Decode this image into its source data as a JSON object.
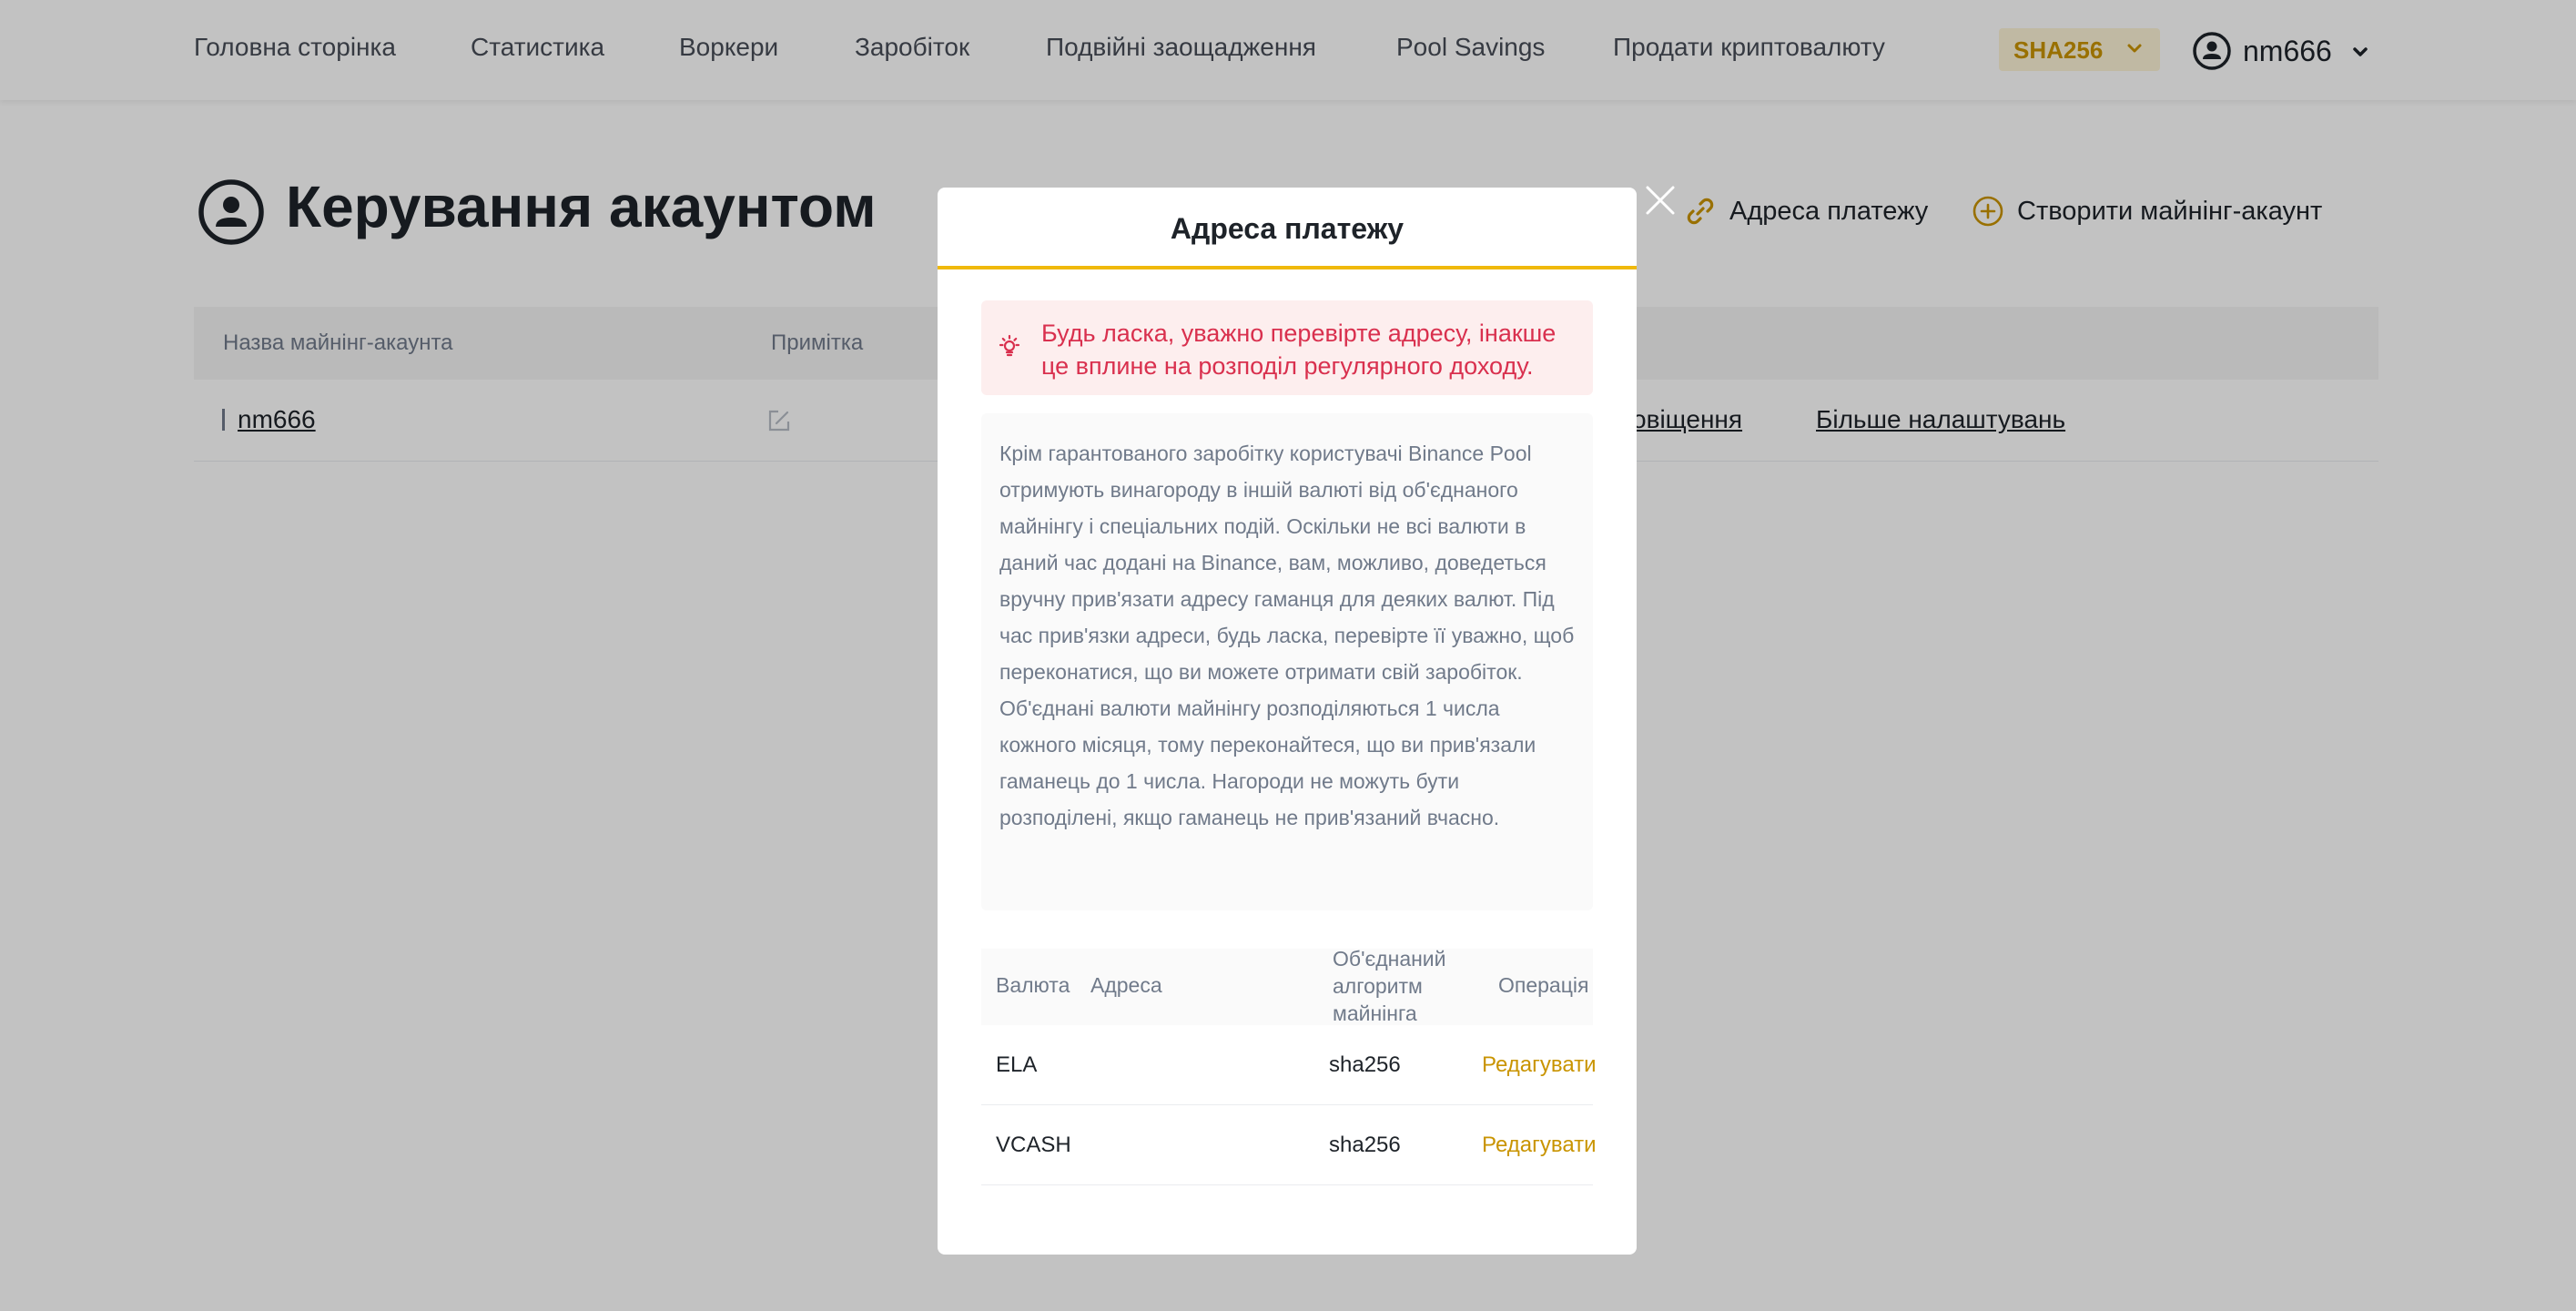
{
  "nav": {
    "items": [
      {
        "label": "Головна сторінка"
      },
      {
        "label": "Статистика"
      },
      {
        "label": "Воркери"
      },
      {
        "label": "Заробіток"
      },
      {
        "label": "Подвійні заощадження"
      },
      {
        "label": "Pool Savings"
      },
      {
        "label": "Продати криптовалюту"
      }
    ],
    "algorithm": "SHA256",
    "username": "nm666"
  },
  "page": {
    "title": "Керування акаунтом",
    "actions": {
      "payment_address": "Адреса платежу",
      "create_account": "Створити майнінг-акаунт"
    },
    "table": {
      "headers": {
        "account_name": "Назва майнінг-акаунта",
        "note": "Примітка"
      },
      "rows": [
        {
          "name": "nm666",
          "notifications_link": "овіщення",
          "more_settings_link": "Більше налаштувань"
        }
      ]
    }
  },
  "modal": {
    "title": "Адреса платежу",
    "warning": "Будь ласка, уважно перевірте адресу, інакше це вплине на розподіл регулярного доходу.",
    "info": "Крім гарантованого заробітку користувачі Binance Pool отримують винагороду в іншій валюті від об'єднаного майнінгу і спеціальних подій. Оскільки не всі валюти в даний час додані на Binance, вам, можливо, доведеться вручну прив'язати адресу гаманця для деяких валют. Під час прив'язки адреси, будь ласка, перевірте її уважно, щоб переконатися, що ви можете отримати свій заробіток. Об'єднані валюти майнінгу розподіляються 1 числа кожного місяця, тому переконайтеся, що ви прив'язали гаманець до 1 числа. Нагороди не можуть бути розподілені, якщо гаманець не прив'язаний вчасно.",
    "table": {
      "headers": {
        "currency": "Валюта",
        "address": "Адреса",
        "algorithm_l1": "Об'єднаний",
        "algorithm_l2": "алгоритм",
        "algorithm_l3": "майнінга",
        "operation": "Операція"
      },
      "rows": [
        {
          "currency": "ELA",
          "address": "",
          "algorithm": "sha256",
          "action": "Редагувати"
        },
        {
          "currency": "VCASH",
          "address": "",
          "algorithm": "sha256",
          "action": "Редагувати"
        }
      ]
    }
  },
  "colors": {
    "accent": "#f0b90b",
    "accent_text": "#c99400",
    "warning_text": "#d9304e",
    "warning_bg": "#fdeeee"
  }
}
